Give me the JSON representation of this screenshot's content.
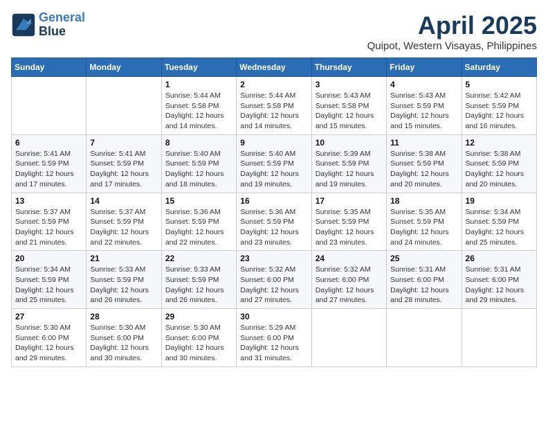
{
  "header": {
    "logo_line1": "General",
    "logo_line2": "Blue",
    "month": "April 2025",
    "location": "Quipot, Western Visayas, Philippines"
  },
  "weekdays": [
    "Sunday",
    "Monday",
    "Tuesday",
    "Wednesday",
    "Thursday",
    "Friday",
    "Saturday"
  ],
  "weeks": [
    [
      {
        "day": "",
        "info": ""
      },
      {
        "day": "",
        "info": ""
      },
      {
        "day": "1",
        "info": "Sunrise: 5:44 AM\nSunset: 5:58 PM\nDaylight: 12 hours and 14 minutes."
      },
      {
        "day": "2",
        "info": "Sunrise: 5:44 AM\nSunset: 5:58 PM\nDaylight: 12 hours and 14 minutes."
      },
      {
        "day": "3",
        "info": "Sunrise: 5:43 AM\nSunset: 5:58 PM\nDaylight: 12 hours and 15 minutes."
      },
      {
        "day": "4",
        "info": "Sunrise: 5:43 AM\nSunset: 5:59 PM\nDaylight: 12 hours and 15 minutes."
      },
      {
        "day": "5",
        "info": "Sunrise: 5:42 AM\nSunset: 5:59 PM\nDaylight: 12 hours and 16 minutes."
      }
    ],
    [
      {
        "day": "6",
        "info": "Sunrise: 5:41 AM\nSunset: 5:59 PM\nDaylight: 12 hours and 17 minutes."
      },
      {
        "day": "7",
        "info": "Sunrise: 5:41 AM\nSunset: 5:59 PM\nDaylight: 12 hours and 17 minutes."
      },
      {
        "day": "8",
        "info": "Sunrise: 5:40 AM\nSunset: 5:59 PM\nDaylight: 12 hours and 18 minutes."
      },
      {
        "day": "9",
        "info": "Sunrise: 5:40 AM\nSunset: 5:59 PM\nDaylight: 12 hours and 19 minutes."
      },
      {
        "day": "10",
        "info": "Sunrise: 5:39 AM\nSunset: 5:59 PM\nDaylight: 12 hours and 19 minutes."
      },
      {
        "day": "11",
        "info": "Sunrise: 5:38 AM\nSunset: 5:59 PM\nDaylight: 12 hours and 20 minutes."
      },
      {
        "day": "12",
        "info": "Sunrise: 5:38 AM\nSunset: 5:59 PM\nDaylight: 12 hours and 20 minutes."
      }
    ],
    [
      {
        "day": "13",
        "info": "Sunrise: 5:37 AM\nSunset: 5:59 PM\nDaylight: 12 hours and 21 minutes."
      },
      {
        "day": "14",
        "info": "Sunrise: 5:37 AM\nSunset: 5:59 PM\nDaylight: 12 hours and 22 minutes."
      },
      {
        "day": "15",
        "info": "Sunrise: 5:36 AM\nSunset: 5:59 PM\nDaylight: 12 hours and 22 minutes."
      },
      {
        "day": "16",
        "info": "Sunrise: 5:36 AM\nSunset: 5:59 PM\nDaylight: 12 hours and 23 minutes."
      },
      {
        "day": "17",
        "info": "Sunrise: 5:35 AM\nSunset: 5:59 PM\nDaylight: 12 hours and 23 minutes."
      },
      {
        "day": "18",
        "info": "Sunrise: 5:35 AM\nSunset: 5:59 PM\nDaylight: 12 hours and 24 minutes."
      },
      {
        "day": "19",
        "info": "Sunrise: 5:34 AM\nSunset: 5:59 PM\nDaylight: 12 hours and 25 minutes."
      }
    ],
    [
      {
        "day": "20",
        "info": "Sunrise: 5:34 AM\nSunset: 5:59 PM\nDaylight: 12 hours and 25 minutes."
      },
      {
        "day": "21",
        "info": "Sunrise: 5:33 AM\nSunset: 5:59 PM\nDaylight: 12 hours and 26 minutes."
      },
      {
        "day": "22",
        "info": "Sunrise: 5:33 AM\nSunset: 5:59 PM\nDaylight: 12 hours and 26 minutes."
      },
      {
        "day": "23",
        "info": "Sunrise: 5:32 AM\nSunset: 6:00 PM\nDaylight: 12 hours and 27 minutes."
      },
      {
        "day": "24",
        "info": "Sunrise: 5:32 AM\nSunset: 6:00 PM\nDaylight: 12 hours and 27 minutes."
      },
      {
        "day": "25",
        "info": "Sunrise: 5:31 AM\nSunset: 6:00 PM\nDaylight: 12 hours and 28 minutes."
      },
      {
        "day": "26",
        "info": "Sunrise: 5:31 AM\nSunset: 6:00 PM\nDaylight: 12 hours and 29 minutes."
      }
    ],
    [
      {
        "day": "27",
        "info": "Sunrise: 5:30 AM\nSunset: 6:00 PM\nDaylight: 12 hours and 29 minutes."
      },
      {
        "day": "28",
        "info": "Sunrise: 5:30 AM\nSunset: 6:00 PM\nDaylight: 12 hours and 30 minutes."
      },
      {
        "day": "29",
        "info": "Sunrise: 5:30 AM\nSunset: 6:00 PM\nDaylight: 12 hours and 30 minutes."
      },
      {
        "day": "30",
        "info": "Sunrise: 5:29 AM\nSunset: 6:00 PM\nDaylight: 12 hours and 31 minutes."
      },
      {
        "day": "",
        "info": ""
      },
      {
        "day": "",
        "info": ""
      },
      {
        "day": "",
        "info": ""
      }
    ]
  ]
}
